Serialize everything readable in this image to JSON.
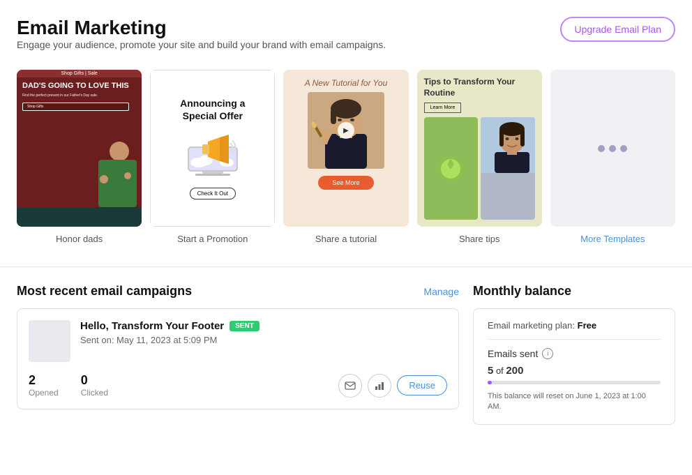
{
  "header": {
    "title": "Email Marketing",
    "subtitle": "Engage your audience, promote your site and build your brand with email campaigns.",
    "upgrade_button": "Upgrade Email Plan"
  },
  "templates": [
    {
      "id": "honor-dads",
      "label": "Honor dads",
      "type": "image-card",
      "top_bar": "Shop Gifts | Sale",
      "headline": "DAD'S GOING TO LOVE THIS",
      "description": "Find the perfect present in our Father's Day sale.",
      "btn_text": "Shop Gifts"
    },
    {
      "id": "start-promotion",
      "label": "Start a Promotion",
      "type": "promo-card",
      "headline": "Announcing a Special Offer",
      "btn_text": "Check It Out"
    },
    {
      "id": "share-tutorial",
      "label": "Share a tutorial",
      "type": "tutorial-card",
      "headline": "A New Tutorial for You",
      "btn_text": "See More"
    },
    {
      "id": "share-tips",
      "label": "Share tips",
      "type": "tips-card",
      "headline": "Tips to Transform Your Routine",
      "btn_text": "Learn More"
    },
    {
      "id": "more-templates",
      "label": "More Templates",
      "type": "more"
    }
  ],
  "campaigns": {
    "section_title": "Most recent email campaigns",
    "manage_label": "Manage",
    "items": [
      {
        "id": "hello-transform",
        "name": "Hello, Transform Your Footer",
        "status": "SENT",
        "sent_on": "Sent on: May 11, 2023 at 5:09 PM",
        "opened": 2,
        "opened_label": "Opened",
        "clicked": 0,
        "clicked_label": "Clicked"
      }
    ]
  },
  "balance": {
    "section_title": "Monthly balance",
    "plan_label": "Email marketing plan:",
    "plan_name": "Free",
    "emails_sent_label": "Emails sent",
    "sent_count": "5",
    "sent_total": "200",
    "progress_percent": 2.5,
    "reset_note": "This balance will reset on June 1, 2023 at 1:00 AM.",
    "actions": {
      "email_icon": "✉",
      "chart_icon": "📊",
      "reuse_label": "Reuse"
    }
  }
}
